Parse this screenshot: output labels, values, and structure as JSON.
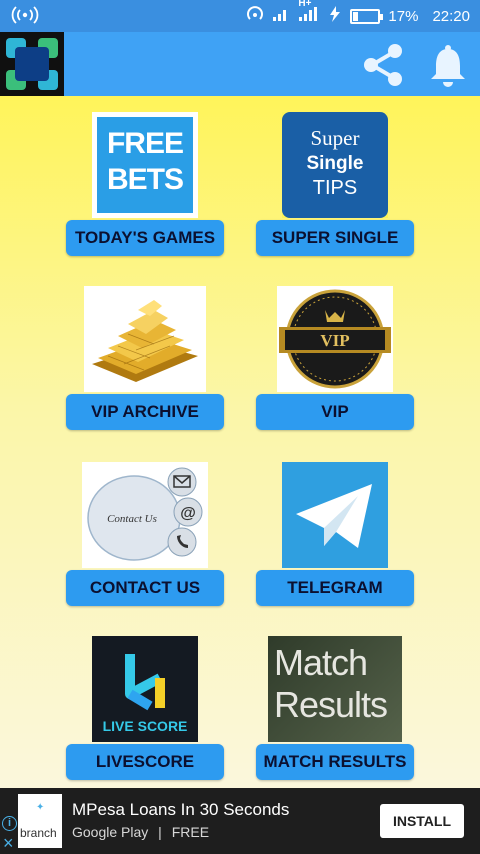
{
  "status_bar": {
    "left_icon": "wireless-hotspot-icon",
    "battery_percent": "17%",
    "battery_level": 0.17,
    "time": "22:20",
    "network_label": "H+"
  },
  "app_bar": {
    "logo_icon": "app-logo-icon",
    "share_icon": "share-icon",
    "bell_icon": "bell-icon",
    "accent_color": "#3fa2f5"
  },
  "tiles": [
    {
      "id": "todays-games",
      "label": "TODAY'S GAMES",
      "image_text_1": "FREE",
      "image_text_2": "BETS"
    },
    {
      "id": "super-single",
      "label": "SUPER SINGLE",
      "image_text_1": "Super",
      "image_text_2": "Single",
      "image_text_3": "TIPS"
    },
    {
      "id": "vip-archive",
      "label": "VIP ARCHIVE"
    },
    {
      "id": "vip",
      "label": "VIP",
      "image_text_1": "VIP"
    },
    {
      "id": "contact-us",
      "label": "CONTACT US",
      "image_text_1": "Contact Us"
    },
    {
      "id": "telegram",
      "label": "TELEGRAM"
    },
    {
      "id": "livescore",
      "label": "LIVESCORE",
      "image_text_1": "LIVE SCORE"
    },
    {
      "id": "match-results",
      "label": "MATCH RESULTS",
      "image_text_1": "Match",
      "image_text_2": "Results"
    }
  ],
  "ad": {
    "brand": "branch",
    "title": "MPesa Loans In 30 Seconds",
    "store": "Google Play",
    "separator": "|",
    "price": "FREE",
    "install_label": "INSTALL",
    "info_glyph": "i",
    "close_glyph": "×"
  },
  "colors": {
    "status_bar": "#3a8fe0",
    "button_bg": "#2d9bf0",
    "background_top": "#fff45a",
    "background_bottom": "#fbf7dc"
  }
}
